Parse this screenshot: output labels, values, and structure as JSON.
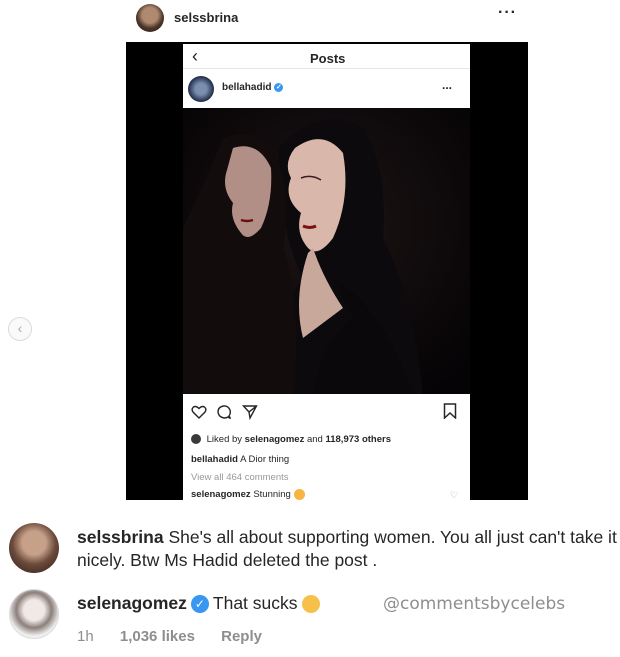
{
  "header": {
    "username": "selssbrina",
    "more_icon": "more-dots-icon"
  },
  "carousel": {
    "prev_icon": "chevron-left-icon"
  },
  "embedded_post": {
    "back_icon": "chevron-left-icon",
    "title": "Posts",
    "username": "bellahadid",
    "verified": true,
    "more_label": "...",
    "liked_by_prefix": "Liked by",
    "liked_by_user": "selenagomez",
    "liked_by_suffix": "and",
    "liked_by_others": "118,973 others",
    "caption_user": "bellahadid",
    "caption_text": "A Dior thing",
    "view_all": "View all 464 comments",
    "comment_user": "selenagomez",
    "comment_text": "Stunning"
  },
  "comments": [
    {
      "username": "selssbrina",
      "text": "She's all about supporting women. You all just can't take it nicely. Btw Ms Hadid deleted the post ."
    },
    {
      "username": "selenagomez",
      "verified": true,
      "text": "That sucks",
      "time": "1h",
      "likes": "1,036 likes",
      "reply_label": "Reply"
    }
  ],
  "watermark": "@commentsbycelebs",
  "colors": {
    "verified": "#3897f0",
    "muted": "#8e8e8e",
    "text": "#262626"
  }
}
